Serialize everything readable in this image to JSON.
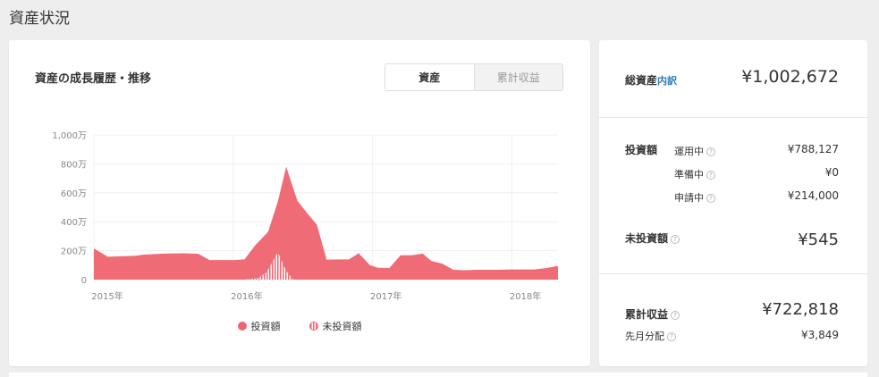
{
  "page": {
    "title": "資産状況"
  },
  "chart_card": {
    "title": "資産の成長履歴・推移",
    "tabs": [
      {
        "label": "資産",
        "active": true
      },
      {
        "label": "累計収益",
        "active": false
      }
    ]
  },
  "chart_data": {
    "type": "area",
    "y_unit": "万円",
    "ylim": [
      0,
      1000
    ],
    "y_ticks": [
      {
        "value": 0,
        "label": "0"
      },
      {
        "value": 200,
        "label": "200万"
      },
      {
        "value": 400,
        "label": "400万"
      },
      {
        "value": 600,
        "label": "600万"
      },
      {
        "value": 800,
        "label": "800万"
      },
      {
        "value": 1000,
        "label": "1,000万"
      }
    ],
    "x_ticks": [
      {
        "value": 2015.0,
        "label": "2015年"
      },
      {
        "value": 2016.0,
        "label": "2016年"
      },
      {
        "value": 2017.0,
        "label": "2017年"
      },
      {
        "value": 2018.0,
        "label": "2018年"
      }
    ],
    "xlim": [
      2015.0,
      2018.33
    ],
    "grid": true,
    "legend": "bottom",
    "colors": {
      "invested": "#ee6470",
      "uninvested": "#ee6470"
    },
    "series": [
      {
        "name": "投資額",
        "style": "solid",
        "points": [
          [
            2015.0,
            215
          ],
          [
            2015.1,
            158
          ],
          [
            2015.3,
            165
          ],
          [
            2015.35,
            172
          ],
          [
            2015.5,
            180
          ],
          [
            2015.65,
            182
          ],
          [
            2015.75,
            178
          ],
          [
            2015.83,
            135
          ],
          [
            2016.0,
            135
          ],
          [
            2016.08,
            140
          ],
          [
            2016.16,
            240
          ],
          [
            2016.25,
            330
          ],
          [
            2016.32,
            540
          ],
          [
            2016.38,
            780
          ],
          [
            2016.46,
            545
          ],
          [
            2016.53,
            460
          ],
          [
            2016.6,
            380
          ],
          [
            2016.67,
            138
          ],
          [
            2016.75,
            140
          ],
          [
            2016.83,
            140
          ],
          [
            2016.9,
            183
          ],
          [
            2016.98,
            100
          ],
          [
            2017.04,
            82
          ],
          [
            2017.12,
            80
          ],
          [
            2017.2,
            168
          ],
          [
            2017.28,
            168
          ],
          [
            2017.36,
            180
          ],
          [
            2017.42,
            130
          ],
          [
            2017.5,
            110
          ],
          [
            2017.58,
            68
          ],
          [
            2017.65,
            65
          ],
          [
            2017.75,
            68
          ],
          [
            2017.9,
            68
          ],
          [
            2018.0,
            70
          ],
          [
            2018.08,
            70
          ],
          [
            2018.16,
            70
          ],
          [
            2018.25,
            80
          ],
          [
            2018.33,
            95
          ]
        ]
      },
      {
        "name": "未投資額",
        "style": "striped",
        "points": [
          [
            2016.08,
            0
          ],
          [
            2016.18,
            10
          ],
          [
            2016.24,
            50
          ],
          [
            2016.32,
            190
          ],
          [
            2016.38,
            60
          ],
          [
            2016.43,
            0
          ]
        ]
      }
    ]
  },
  "summary": {
    "total": {
      "label": "総資産",
      "link": "内訳",
      "value": "¥1,002,672"
    },
    "invested": {
      "label": "投資額",
      "rows": [
        {
          "label": "運用中",
          "value": "¥788,127"
        },
        {
          "label": "準備中",
          "value": "¥0"
        },
        {
          "label": "申請中",
          "value": "¥214,000"
        }
      ]
    },
    "uninvested": {
      "label": "未投資額",
      "value": "¥545"
    },
    "cumulative": {
      "label": "累計収益",
      "value": "¥722,818"
    },
    "last_month": {
      "label": "先月分配",
      "value": "¥3,849"
    },
    "help_glyph": "?"
  }
}
